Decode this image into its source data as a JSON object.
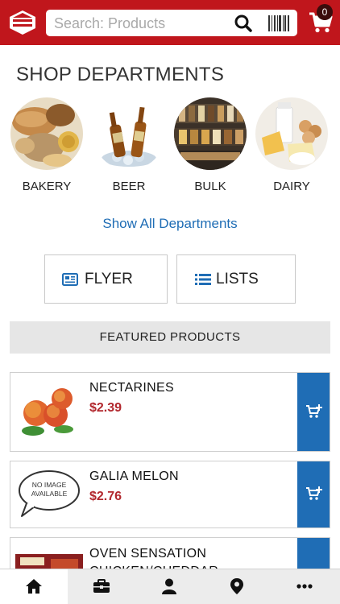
{
  "header": {
    "search_placeholder": "Search: Products",
    "cart_count": "0",
    "brand_color": "#c0161c"
  },
  "departments_section": {
    "title": "SHOP DEPARTMENTS",
    "items": [
      {
        "label": "BAKERY",
        "icon": "bakery-image"
      },
      {
        "label": "BEER",
        "icon": "beer-image"
      },
      {
        "label": "BULK",
        "icon": "bulk-image"
      },
      {
        "label": "DAIRY",
        "icon": "dairy-image"
      }
    ],
    "show_all": "Show All Departments"
  },
  "actions": {
    "flyer_label": "FLYER",
    "lists_label": "LISTS"
  },
  "featured": {
    "title": "FEATURED PRODUCTS",
    "products": [
      {
        "name": "NECTARINES",
        "price": "$2.39",
        "image": "nectarines-image"
      },
      {
        "name": "GALIA MELON",
        "price": "$2.76",
        "image": "no-image-available"
      },
      {
        "name": "OVEN SENSATION CHICKEN/CHEDDAR",
        "price": "",
        "image": "oven-sensation-image"
      }
    ],
    "no_image_text_line1": "NO IMAGE",
    "no_image_text_line2": "AVAILABLE"
  },
  "bottom_nav": {
    "items": [
      "home-icon",
      "briefcase-icon",
      "user-icon",
      "location-pin-icon",
      "more-icon"
    ],
    "active": "home-icon"
  },
  "colors": {
    "accent_blue": "#1f6db5",
    "price_red": "#b2282e"
  }
}
